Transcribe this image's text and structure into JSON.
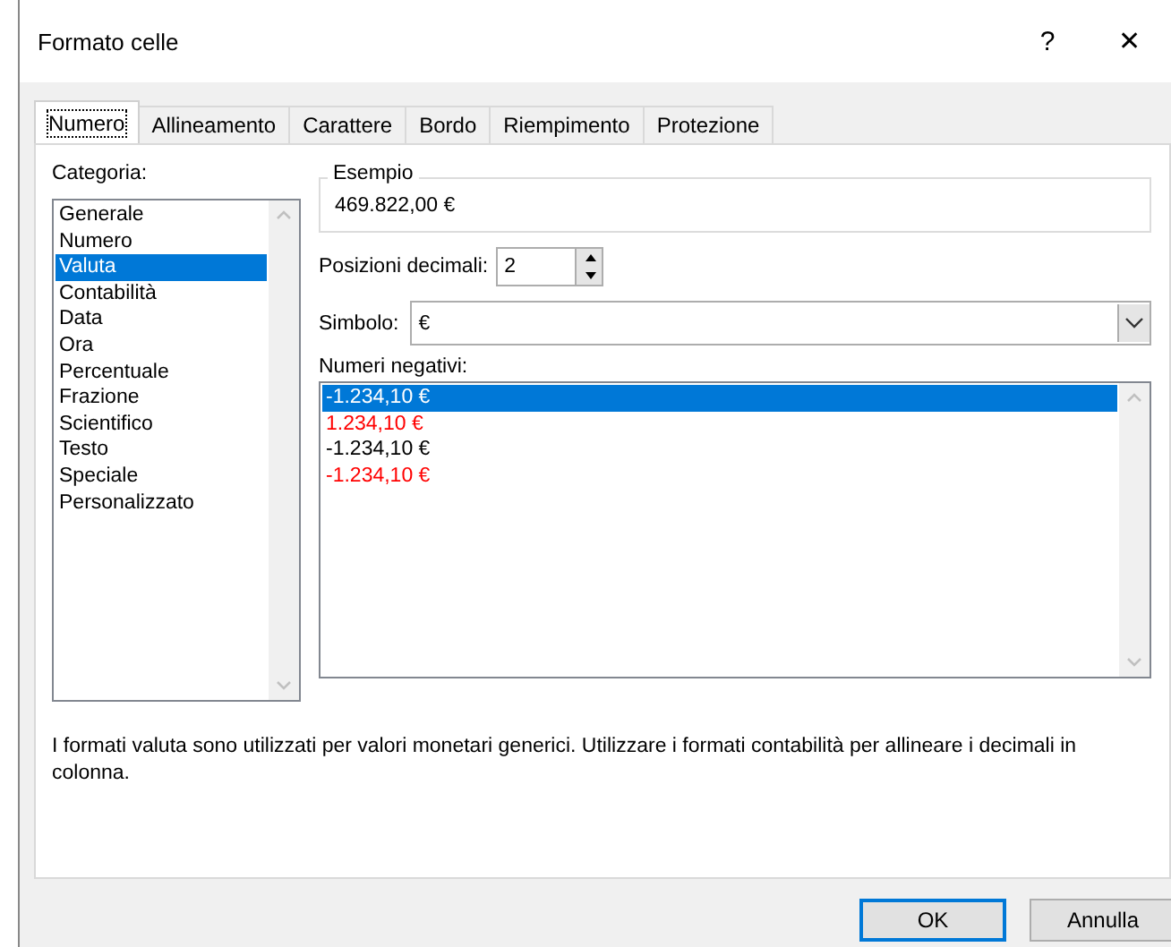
{
  "window": {
    "title": "Formato celle",
    "help_button": "?",
    "close_button": "✕"
  },
  "tabs": [
    {
      "label": "Numero",
      "selected": true
    },
    {
      "label": "Allineamento",
      "selected": false
    },
    {
      "label": "Carattere",
      "selected": false
    },
    {
      "label": "Bordo",
      "selected": false
    },
    {
      "label": "Riempimento",
      "selected": false
    },
    {
      "label": "Protezione",
      "selected": false
    }
  ],
  "category": {
    "label": "Categoria:",
    "items": [
      {
        "label": "Generale",
        "selected": false
      },
      {
        "label": "Numero",
        "selected": false
      },
      {
        "label": "Valuta",
        "selected": true
      },
      {
        "label": "Contabilità",
        "selected": false
      },
      {
        "label": "Data",
        "selected": false
      },
      {
        "label": "Ora",
        "selected": false
      },
      {
        "label": "Percentuale",
        "selected": false
      },
      {
        "label": "Frazione",
        "selected": false
      },
      {
        "label": "Scientifico",
        "selected": false
      },
      {
        "label": "Testo",
        "selected": false
      },
      {
        "label": "Speciale",
        "selected": false
      },
      {
        "label": "Personalizzato",
        "selected": false
      }
    ]
  },
  "sample": {
    "label": "Esempio",
    "value": "469.822,00 €"
  },
  "decimal_places": {
    "label": "Posizioni decimali:",
    "value": "2"
  },
  "symbol": {
    "label": "Simbolo:",
    "value": "€"
  },
  "negative_numbers": {
    "label": "Numeri negativi:",
    "items": [
      {
        "label": "-1.234,10 €",
        "selected": true
      },
      {
        "label": "1.234,10 €",
        "color": "#ff0000",
        "selected": false
      },
      {
        "label": "-1.234,10 €",
        "color": "#000000",
        "selected": false
      },
      {
        "label": "-1.234,10 €",
        "color": "#ff0000",
        "selected": false
      }
    ]
  },
  "description": "I formati valuta sono utilizzati per valori monetari generici. Utilizzare i formati contabilità per allineare i decimali in colonna.",
  "buttons": [
    {
      "label": "OK",
      "default": true
    },
    {
      "label": "Annulla",
      "default": false
    }
  ]
}
